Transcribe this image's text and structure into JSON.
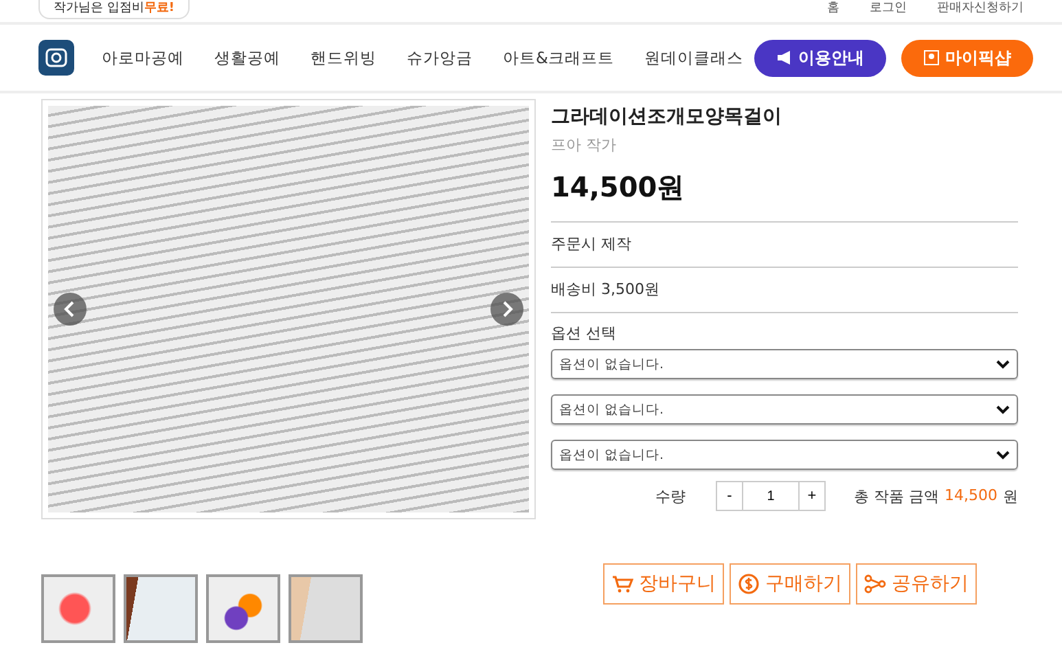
{
  "top_bar": {
    "promo": {
      "text": "작가님은 입점비 ",
      "highlight": "무료!"
    },
    "links": [
      "홈",
      "로그인",
      "판매자신청하기"
    ]
  },
  "header": {
    "nav": [
      "아로마공예",
      "생활공예",
      "핸드위빙",
      "슈가앙금",
      "아트&크래프트",
      "원데이클래스"
    ],
    "buttons": [
      {
        "kind": "guide",
        "label": "이용안내"
      },
      {
        "kind": "mypage",
        "label": "마이픽샵"
      }
    ]
  },
  "gallery": {
    "thumbnails": [
      {
        "kind": "shell"
      },
      {
        "kind": "book"
      },
      {
        "kind": "pair"
      },
      {
        "kind": "side"
      }
    ]
  },
  "product": {
    "title": "그라데이션조개모양목걸이",
    "artist": "프아 작가",
    "price": "14,500원",
    "made_to_order": "주문시 제작",
    "shipping": "배송비 3,500원",
    "option_label": "옵션 선택",
    "options": [
      {
        "value": "옵션이 없습니다."
      },
      {
        "value": "옵션이 없습니다."
      },
      {
        "value": "옵션이 없습니다."
      }
    ],
    "quantity": {
      "label": "수량",
      "minus": "-",
      "value": "1",
      "plus": "+"
    },
    "total": {
      "label": "총 작품 금액",
      "amount": "14,500",
      "unit": "원"
    },
    "actions": [
      {
        "kind": "cart",
        "label": "장바구니"
      },
      {
        "kind": "buy",
        "label": "구매하기"
      },
      {
        "kind": "share",
        "label": "공유하기"
      }
    ]
  }
}
